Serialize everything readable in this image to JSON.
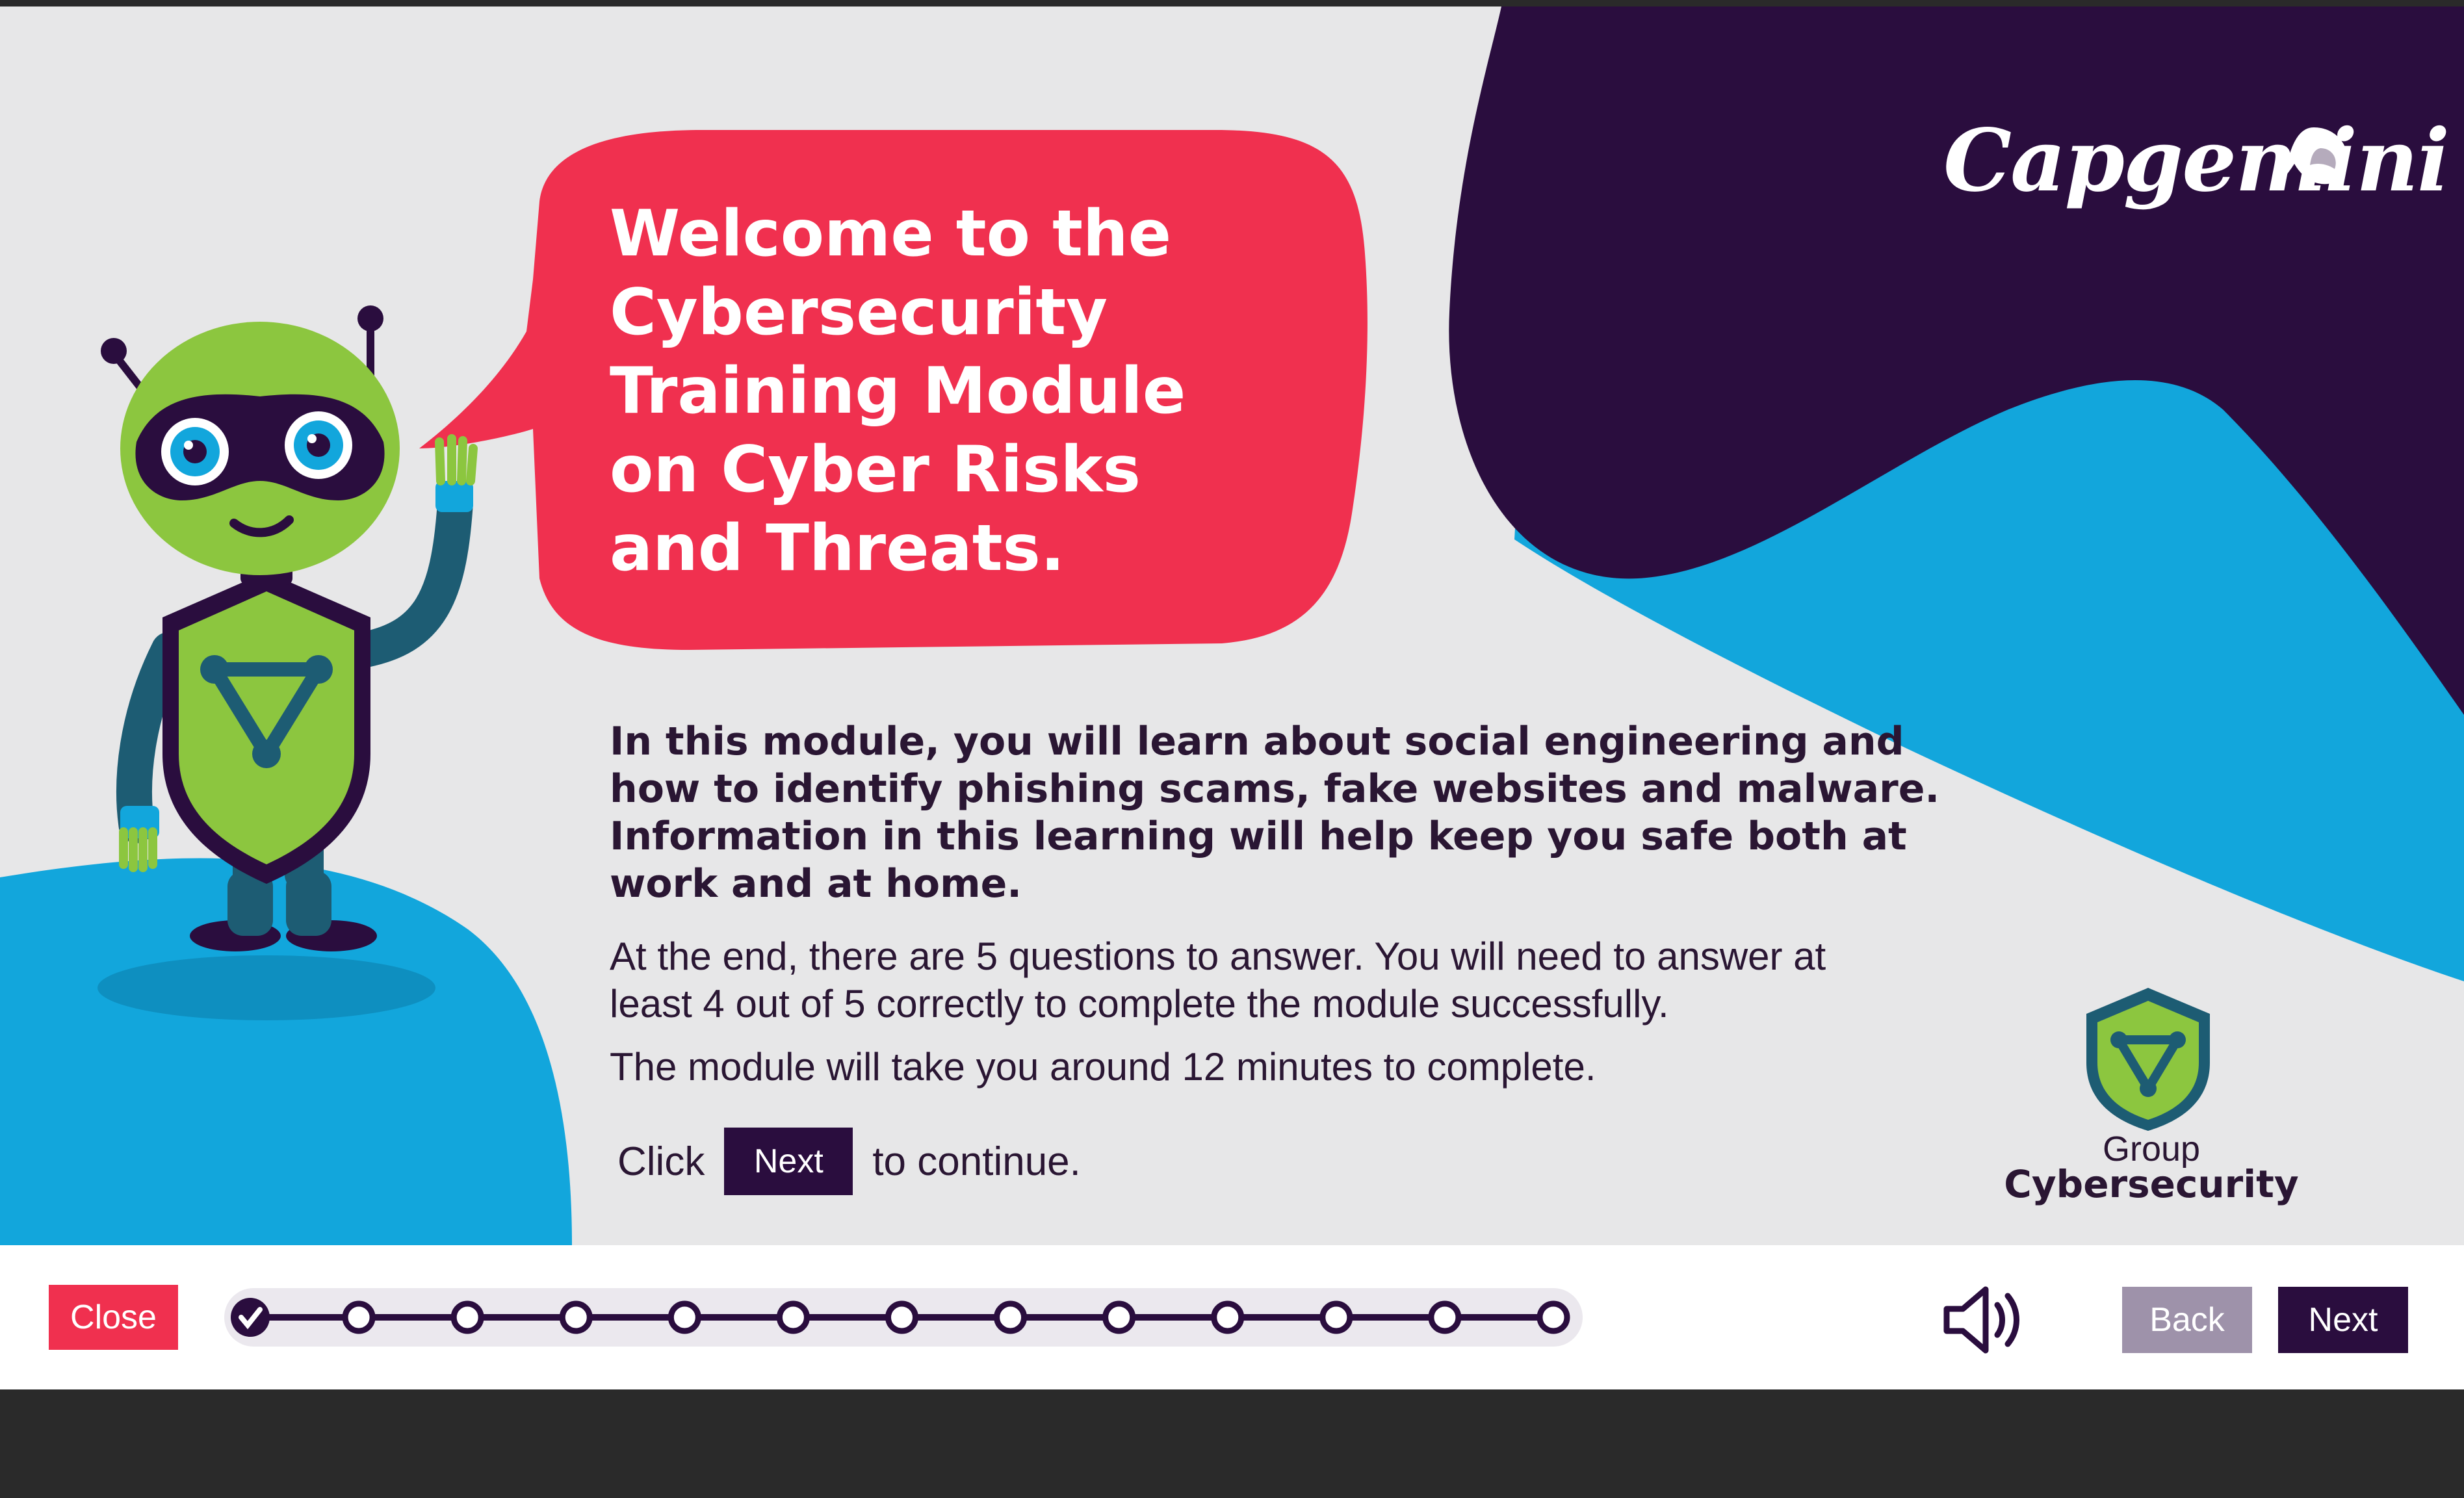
{
  "brand": {
    "logo_text": "Capgemini",
    "colors": {
      "accent_red": "#f0304f",
      "deep_purple": "#2a0d3e",
      "sky_blue": "#12a6dc",
      "robot_green": "#8cc63f",
      "back_button": "#9e92aa"
    }
  },
  "welcome": {
    "headline_lines": [
      "Welcome to the",
      "Cybersecurity",
      "Training Module",
      "on Cyber Risks",
      "and Threats."
    ]
  },
  "content": {
    "intro_lines": [
      "In this module, you will learn about social engineering and",
      "how to identify phishing scams, fake websites and malware.",
      "Information in this learning will help keep you safe both at",
      "work and at home."
    ],
    "questions_lines": [
      "At the end, there are 5 questions to answer. You will need to answer at",
      "least 4 out of 5 correctly to complete the module successfully."
    ],
    "duration": "The module will take you around 12 minutes to complete.",
    "cta": {
      "prefix": "Click",
      "button_label": "Next",
      "suffix": "to continue."
    }
  },
  "badge": {
    "line1": "Group",
    "line2": "Cybersecurity",
    "icon": "shield-icon"
  },
  "footer": {
    "close_label": "Close",
    "back_label": "Back",
    "next_label": "Next",
    "audio_icon": "speaker-icon",
    "progress": {
      "total_steps": 13,
      "completed_steps": 1
    }
  }
}
